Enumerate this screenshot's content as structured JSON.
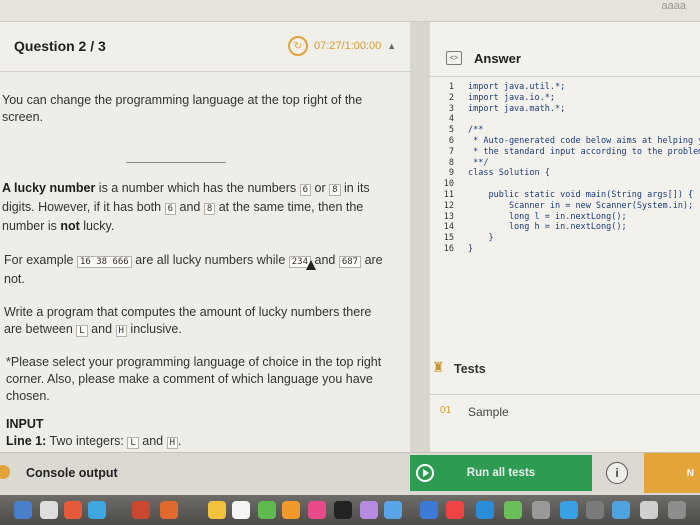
{
  "topstrip": {
    "ghost_text": "aaaa"
  },
  "question": {
    "title": "Question 2 / 3",
    "timer": "07:27/1:00:00"
  },
  "problem": {
    "intro": "You can change the programming language at the top right of the screen.",
    "lucky_def_bold": "A lucky number",
    "lucky_def_1": " is a number which has the numbers ",
    "digit_a": "6",
    "lucky_def_2": " or ",
    "digit_b": "8",
    "lucky_def_3": " in its digits. However, if it has both ",
    "lucky_def_4": " and ",
    "lucky_def_5": " at the same time, then the number is ",
    "not_bold": "not",
    "lucky_def_6": " lucky.",
    "example_1": "For example ",
    "example_chip": "16 38 666",
    "example_2": " are all lucky numbers while ",
    "chip_234": "234",
    "example_3": " and ",
    "chip_687": "687",
    "example_4": " are not.",
    "task_1": "Write a program that computes the amount of lucky numbers there are between ",
    "chip_L": "L",
    "task_2": " and ",
    "chip_H": "H",
    "task_3": " inclusive.",
    "note": "*Please select your programming language of choice in the top right corner. Also, please make a comment of which language you have chosen.",
    "input_heading": "INPUT",
    "line1_bold": "Line 1:",
    "line1_text": " Two integers: ",
    "line1_and": " and ",
    "line1_end": "."
  },
  "answer": {
    "title": "Answer",
    "line_numbers": [
      "1",
      "2",
      "3",
      "4",
      "5",
      "6",
      "7",
      "8",
      "9",
      "10",
      "11",
      "12",
      "13",
      "14",
      "15",
      "16"
    ],
    "code_lines": [
      "import java.util.*;",
      "import java.io.*;",
      "import java.math.*;",
      "",
      "/**",
      " * Auto-generated code below aims at helping you parse",
      " * the standard input according to the problem statement.",
      " **/",
      "class Solution {",
      "",
      "    public static void main(String args[]) {",
      "        Scanner in = new Scanner(System.in);",
      "        long l = in.nextLong();",
      "        long h = in.nextLong();",
      "    }",
      "}"
    ]
  },
  "tests": {
    "title": "Tests",
    "sample_number": "01",
    "sample_label": "Sample"
  },
  "bottom": {
    "console_label": "Console output",
    "run_label": "Run all tests",
    "info_label": "i",
    "next_label": "N"
  },
  "colors": {
    "accent": "#e2a23a",
    "run_green": "#2d9b52",
    "code_blue": "#1c3d7c"
  }
}
